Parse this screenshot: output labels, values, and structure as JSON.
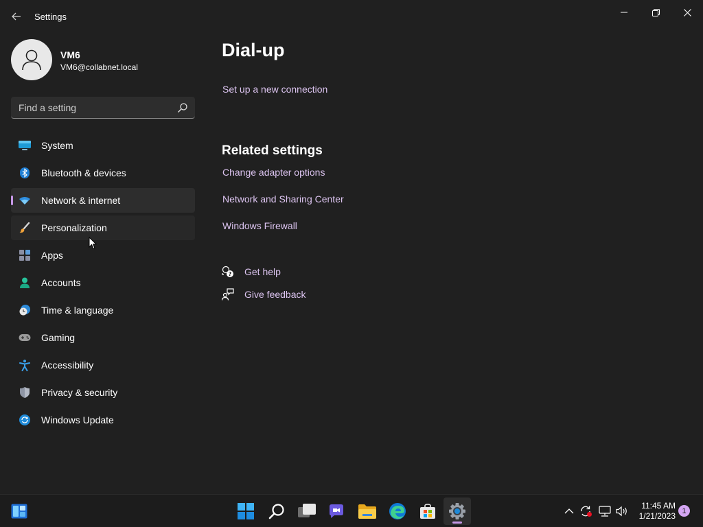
{
  "window": {
    "title": "Settings",
    "back_icon": "arrow-left-icon",
    "controls": [
      "minimize-icon",
      "restore-icon",
      "close-icon"
    ]
  },
  "profile": {
    "name": "VM6",
    "email": "VM6@collabnet.local",
    "avatar_icon": "person-icon"
  },
  "search": {
    "placeholder": "Find a setting",
    "value": "",
    "icon": "search-icon"
  },
  "sidebar": {
    "accent": "#c597e6",
    "items": [
      {
        "label": "System",
        "icon": "system-icon"
      },
      {
        "label": "Bluetooth & devices",
        "icon": "bluetooth-icon"
      },
      {
        "label": "Network & internet",
        "icon": "wifi-icon",
        "selected": true
      },
      {
        "label": "Personalization",
        "icon": "brush-icon",
        "hovered": true
      },
      {
        "label": "Apps",
        "icon": "apps-icon"
      },
      {
        "label": "Accounts",
        "icon": "account-icon"
      },
      {
        "label": "Time & language",
        "icon": "clock-globe-icon"
      },
      {
        "label": "Gaming",
        "icon": "gamepad-icon"
      },
      {
        "label": "Accessibility",
        "icon": "accessibility-icon"
      },
      {
        "label": "Privacy & security",
        "icon": "shield-icon"
      },
      {
        "label": "Windows Update",
        "icon": "update-icon"
      }
    ]
  },
  "main": {
    "title": "Dial-up",
    "setup_link": "Set up a new connection",
    "related_title": "Related settings",
    "related_links": [
      "Change adapter options",
      "Network and Sharing Center",
      "Windows Firewall"
    ],
    "get_help": "Get help",
    "give_feedback": "Give feedback",
    "link_color": "#dcc4f0"
  },
  "taskbar": {
    "apps": [
      "widgets-icon",
      "start-icon",
      "search-icon",
      "task-view-icon",
      "chat-icon",
      "file-explorer-icon",
      "edge-icon",
      "store-icon",
      "settings-icon"
    ],
    "active_app": "settings-icon",
    "tray": [
      "chevron-up-icon",
      "sync-icon",
      "network-icon",
      "volume-icon"
    ],
    "time": "11:45 AM",
    "date": "1/21/2023",
    "notification_count": "1"
  }
}
